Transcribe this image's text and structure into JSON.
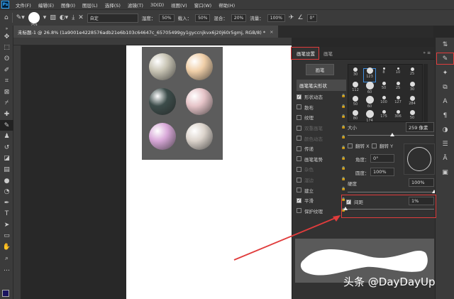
{
  "menu": {
    "items": [
      "文件(F)",
      "编辑(E)",
      "图像(I)",
      "图层(L)",
      "选择(S)",
      "滤镜(T)",
      "3D(D)",
      "视图(V)",
      "窗口(W)",
      "帮助(H)"
    ]
  },
  "options": {
    "brush_size": "259",
    "mode_value": "自定",
    "opacity_label": "湿度：",
    "opacity_value": "50%",
    "load_label": "载入：",
    "load_value": "50%",
    "mix_label": "混合：",
    "mix_value": "20%",
    "flow_label": "流量：",
    "flow_value": "100%",
    "angle_value": "0°"
  },
  "document": {
    "tab_title": "未标题-1 @ 26.8% (1a9001e4228576adb21e6b103c64647c_65705499gy1gyccnjkvx6j20j60r5gmj, RGB/8) *",
    "close": "×"
  },
  "pearls": {
    "colors": [
      "#c8c4b4",
      "#f0cfa8",
      "#3c4c4a",
      "#e6c4c8",
      "#d8a8d8",
      "#dcd4cc"
    ]
  },
  "brush_panel": {
    "tab_settings": "画笔设置",
    "tab_brush": "画笔",
    "brush_button": "画笔",
    "tip_shape": "画笔笔尖形状",
    "options": [
      {
        "label": "形状动态",
        "checked": true,
        "dim": false
      },
      {
        "label": "散布",
        "checked": false,
        "dim": false
      },
      {
        "label": "纹理",
        "checked": false,
        "dim": false
      },
      {
        "label": "双重画笔",
        "checked": false,
        "dim": true
      },
      {
        "label": "颜色动态",
        "checked": false,
        "dim": true
      },
      {
        "label": "传递",
        "checked": false,
        "dim": false
      },
      {
        "label": "画笔笔势",
        "checked": false,
        "dim": false
      },
      {
        "label": "杂色",
        "checked": false,
        "dim": true
      },
      {
        "label": "湿边",
        "checked": false,
        "dim": true
      },
      {
        "label": "建立",
        "checked": false,
        "dim": false
      },
      {
        "label": "平滑",
        "checked": true,
        "dim": false
      },
      {
        "label": "保护纹理",
        "checked": false,
        "dim": false
      }
    ],
    "tips": [
      "30",
      "123",
      "8",
      "10",
      "25",
      "112",
      "60",
      "50",
      "25",
      "30",
      "50",
      "60",
      "100",
      "127",
      "284",
      "80",
      "174",
      "175",
      "306",
      "50"
    ],
    "size_label": "大小",
    "size_value": "259 像素",
    "flip_x": "翻转 X",
    "flip_y": "翻转 Y",
    "angle_label": "角度：",
    "angle_value": "0°",
    "roundness_label": "圆度：",
    "roundness_value": "100%",
    "hardness_label": "硬度",
    "hardness_value": "100%",
    "spacing_label": "间距",
    "spacing_value": "1%",
    "spacing_checked": "✓"
  },
  "watermark": "头条 @DayDayUp"
}
